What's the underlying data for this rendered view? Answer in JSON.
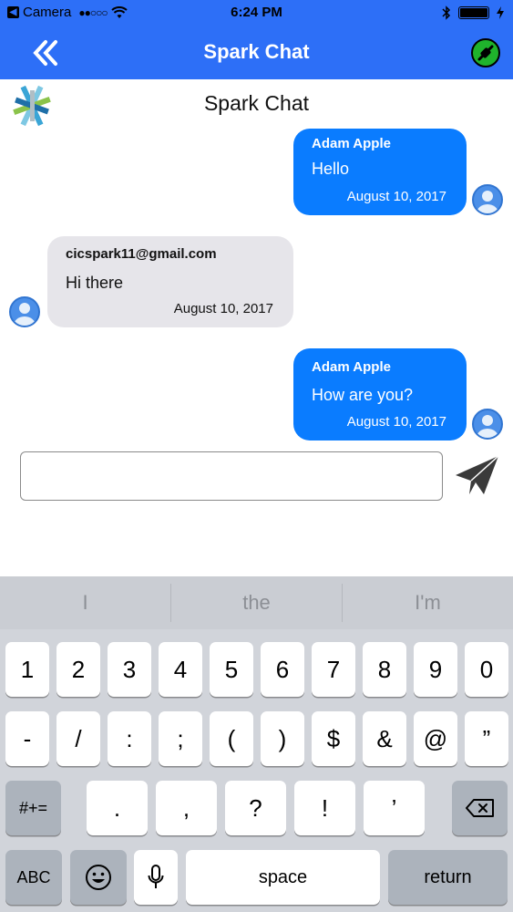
{
  "status_bar": {
    "carrier": "Camera",
    "signal": "●●○○○",
    "time": "6:24 PM"
  },
  "nav": {
    "title": "Spark Chat"
  },
  "header": {
    "title": "Spark Chat"
  },
  "messages": [
    {
      "sender": "Adam Apple",
      "text": "Hello",
      "date": "August 10, 2017",
      "direction": "outgoing"
    },
    {
      "sender": "cicspark11@gmail.com",
      "text": "Hi there",
      "date": "August 10, 2017",
      "direction": "incoming"
    },
    {
      "sender": "Adam Apple",
      "text": "How are you?",
      "date": "August 10, 2017",
      "direction": "outgoing"
    }
  ],
  "composer": {
    "value": ""
  },
  "keyboard": {
    "suggestions": [
      "I",
      "the",
      "I'm"
    ],
    "row1": [
      "1",
      "2",
      "3",
      "4",
      "5",
      "6",
      "7",
      "8",
      "9",
      "0"
    ],
    "row2": [
      "-",
      "/",
      ":",
      ";",
      "(",
      ")",
      "$",
      "&",
      "@",
      "”"
    ],
    "row3_left": "#+=",
    "row3": [
      ".",
      ",",
      "?",
      "!",
      "’"
    ],
    "row4": {
      "abc": "ABC",
      "space": "space",
      "return": "return"
    }
  },
  "colors": {
    "nav_blue": "#2d6ff7",
    "bubble_out": "#0a7cff",
    "bubble_in": "#e6e5ea"
  },
  "icons": [
    "double-chevron-left-icon",
    "connection-status-icon",
    "spark-logo-icon",
    "avatar-icon",
    "send-icon",
    "delete-key-icon",
    "emoji-icon",
    "microphone-icon",
    "wifi-icon",
    "bluetooth-icon",
    "battery-icon"
  ]
}
